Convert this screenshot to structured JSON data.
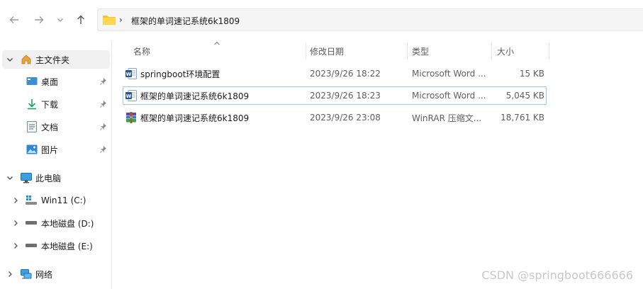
{
  "address_bar": {
    "path_segment": "框架的单词速记系统6k1809",
    "separator": "›"
  },
  "nav": {
    "back_icon": "arrow-left-icon",
    "forward_icon": "arrow-right-icon",
    "recent_icon": "chevron-down-icon",
    "up_icon": "arrow-up-icon"
  },
  "sidebar": {
    "items": [
      {
        "label": "主文件夹",
        "icon": "home-icon",
        "expand": "chevron-down",
        "selected": true
      },
      {
        "label": "桌面",
        "icon": "desktop-icon",
        "pinned": true
      },
      {
        "label": "下载",
        "icon": "download-icon",
        "pinned": true
      },
      {
        "label": "文档",
        "icon": "document-icon",
        "pinned": true
      },
      {
        "label": "图片",
        "icon": "pictures-icon",
        "pinned": true
      },
      {
        "label": "此电脑",
        "icon": "computer-icon",
        "expand": "chevron-down"
      },
      {
        "label": "Win11 (C:)",
        "icon": "windows-drive-icon",
        "expand": "chevron-right"
      },
      {
        "label": "本地磁盘 (D:)",
        "icon": "drive-icon",
        "expand": "chevron-right"
      },
      {
        "label": "本地磁盘 (E:)",
        "icon": "drive-icon",
        "expand": "chevron-right"
      },
      {
        "label": "网络",
        "icon": "network-icon",
        "expand": "chevron-right"
      }
    ]
  },
  "columns": {
    "name": "名称",
    "modified": "修改日期",
    "type": "类型",
    "size": "大小"
  },
  "files": [
    {
      "name": "springboot环境配置",
      "modified": "2023/9/26 18:22",
      "type": "Microsoft Word ...",
      "size": "15 KB",
      "icon": "word-doc-icon"
    },
    {
      "name": "框架的单词速记系统6k1809",
      "modified": "2023/9/26 18:23",
      "type": "Microsoft Word ...",
      "size": "5,045 KB",
      "icon": "word-doc-icon",
      "focused": true
    },
    {
      "name": "框架的单词速记系统6k1809",
      "modified": "2023/9/26 23:08",
      "type": "WinRAR 压缩文...",
      "size": "18,761 KB",
      "icon": "winrar-archive-icon"
    }
  ],
  "watermark": "CSDN @springboot666666",
  "colors": {
    "accent": "#0067c0",
    "selection_border": "#99c9ef",
    "folder_yellow": "#f4c430",
    "word_blue": "#2b579a"
  }
}
